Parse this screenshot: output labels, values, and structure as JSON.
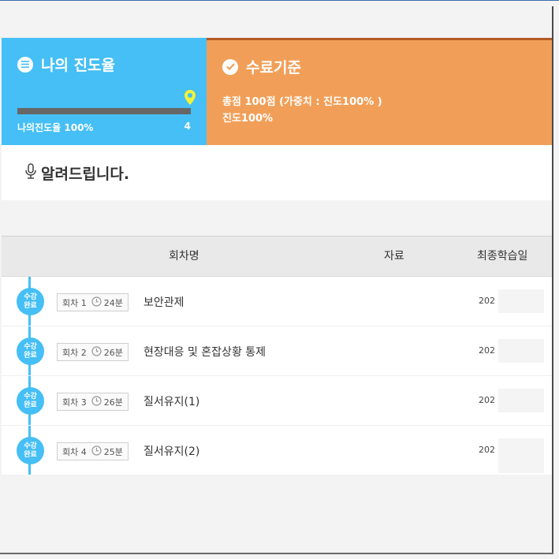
{
  "progress_panel": {
    "title": "나의 진도율",
    "progress_percent": 100,
    "label": "나의진도율 100%",
    "completed_count": "4"
  },
  "criteria_panel": {
    "title": "수료기준",
    "line1": "총점 100점 (가중치 : 진도100% )",
    "line2": "진도100%"
  },
  "notice": {
    "title": "알려드립니다."
  },
  "table": {
    "headers": {
      "name": "회차명",
      "material": "자료",
      "date": "최종학습일"
    },
    "rows": [
      {
        "status": "수강완료",
        "status_line1": "수강",
        "status_line2": "완료",
        "session": "회차 1",
        "duration": "24분",
        "title": "보안관제",
        "date": "202"
      },
      {
        "status": "수강완료",
        "status_line1": "수강",
        "status_line2": "완료",
        "session": "회차 2",
        "duration": "26분",
        "title": "현장대응 및 혼잡상황 통제",
        "date": "202"
      },
      {
        "status": "수강완료",
        "status_line1": "수강",
        "status_line2": "완료",
        "session": "회차 3",
        "duration": "26분",
        "title": "질서유지(1)",
        "date": "202"
      },
      {
        "status": "수강완료",
        "status_line1": "수강",
        "status_line2": "완료",
        "session": "회차 4",
        "duration": "25분",
        "title": "질서유지(2)",
        "date": "202"
      }
    ]
  },
  "colors": {
    "progress_bg": "#45bff5",
    "criteria_bg": "#f19f58",
    "badge": "#45bff5",
    "pin": "#f2f23a"
  }
}
